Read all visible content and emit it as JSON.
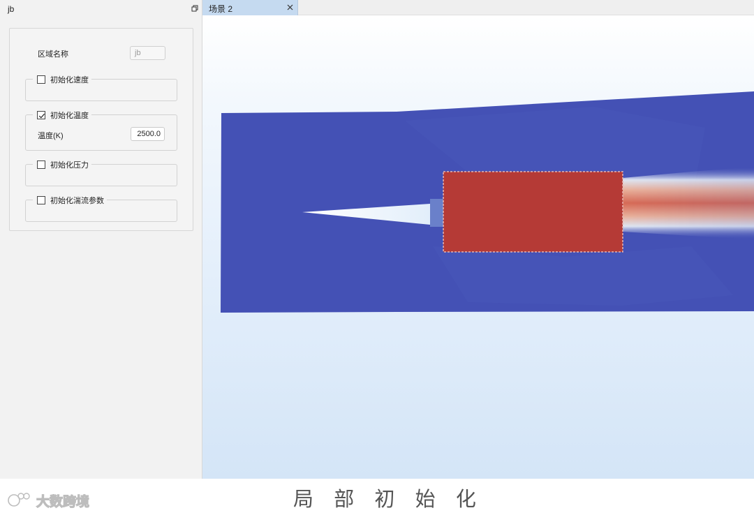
{
  "panel": {
    "title": "jb",
    "restore_icon": "restore-window-icon",
    "zone_name_label": "区域名称",
    "zone_name_value": "jb",
    "groups": {
      "velocity": {
        "label": "初始化速度",
        "checked": false
      },
      "temperature": {
        "label": "初始化温度",
        "checked": true,
        "field_label": "温度(K)",
        "field_value": "2500.0"
      },
      "pressure": {
        "label": "初始化压力",
        "checked": false
      },
      "turbulence": {
        "label": "初始化湍流参数",
        "checked": false
      }
    }
  },
  "scene": {
    "tab_label": "场景 2",
    "close_icon": "close-icon",
    "colors": {
      "cold": "#4451b5",
      "hot": "#b53a36",
      "background": "#e4effb"
    }
  },
  "footer": {
    "caption": "局 部 初 始 化",
    "watermark": "大数跨境"
  }
}
